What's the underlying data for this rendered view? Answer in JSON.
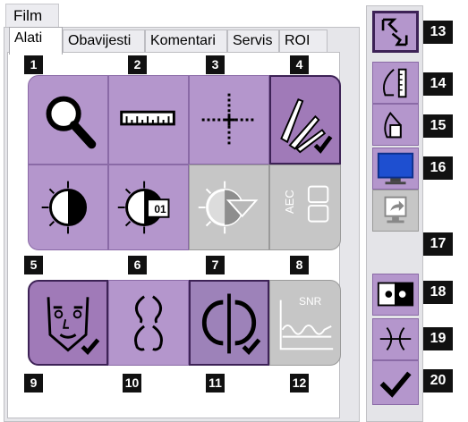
{
  "film_tab": "Film",
  "tabs": [
    "Alati",
    "Obavijesti",
    "Komentari",
    "Servis",
    "ROI"
  ],
  "active_tab": "Alati",
  "tools": [
    {
      "number": "1",
      "icon": "magnifier-icon"
    },
    {
      "number": "2",
      "icon": "ruler-icon"
    },
    {
      "number": "3",
      "icon": "crosshair-icon"
    },
    {
      "number": "4",
      "icon": "pens-checkmark-icon"
    },
    {
      "number": "5",
      "icon": "contrast-icon"
    },
    {
      "number": "6",
      "icon": "window-level-preset-icon",
      "badge": "01"
    },
    {
      "number": "7",
      "icon": "auto-window-level-icon"
    },
    {
      "number": "8",
      "icon": "aec-icon",
      "label": "AEC"
    },
    {
      "number": "9",
      "icon": "face-checkmark-icon"
    },
    {
      "number": "10",
      "icon": "flip-horizontal-icon"
    },
    {
      "number": "11",
      "icon": "invert-checkmark-icon"
    },
    {
      "number": "12",
      "icon": "snr-icon",
      "label": "SNR"
    }
  ],
  "side_tools": [
    {
      "number": "13",
      "icon": "fit-viewport-icon"
    },
    {
      "number": "14",
      "icon": "true-size-icon"
    },
    {
      "number": "15",
      "icon": "bucket-icon"
    },
    {
      "number": "16",
      "icon": "monitor-icon"
    },
    {
      "number": "17",
      "icon": "monitor-send-icon"
    },
    {
      "number": "18",
      "icon": "split-view-icon"
    },
    {
      "number": "19",
      "icon": "lines-icon"
    },
    {
      "number": "20",
      "icon": "accept-checkmark-icon"
    }
  ]
}
